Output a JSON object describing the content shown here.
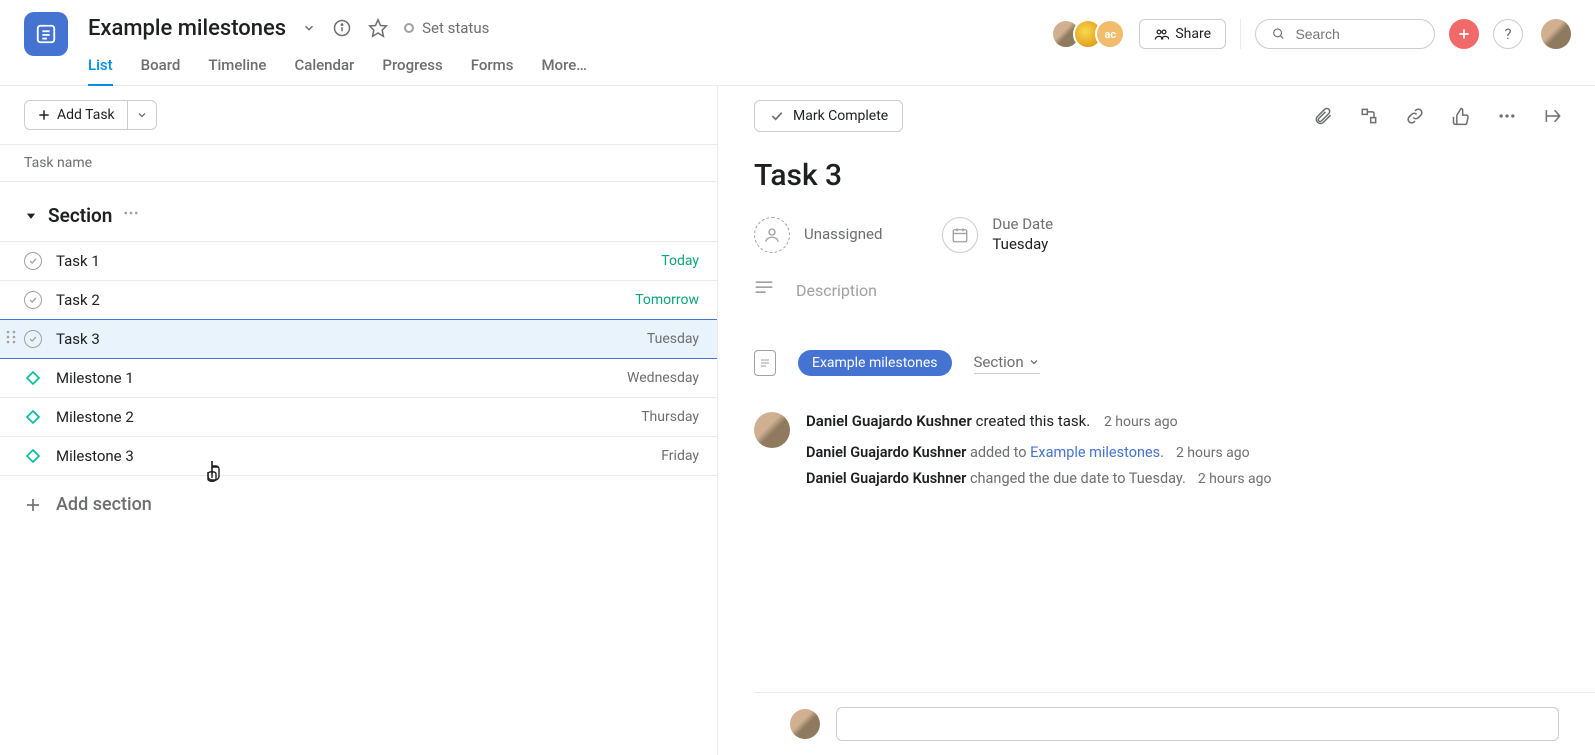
{
  "header": {
    "project_title": "Example milestones",
    "set_status": "Set status",
    "tabs": [
      "List",
      "Board",
      "Timeline",
      "Calendar",
      "Progress",
      "Forms",
      "More…"
    ],
    "active_tab_index": 0,
    "share": "Share",
    "search_placeholder": "Search",
    "avatar3_label": "ac"
  },
  "left": {
    "add_task": "Add Task",
    "column_header": "Task name",
    "section_title": "Section",
    "tasks": [
      {
        "name": "Task 1",
        "date": "Today",
        "date_class": "today",
        "type": "task"
      },
      {
        "name": "Task 2",
        "date": "Tomorrow",
        "date_class": "tomorrow",
        "type": "task"
      },
      {
        "name": "Task 3",
        "date": "Tuesday",
        "date_class": "",
        "type": "task",
        "selected": true
      },
      {
        "name": "Milestone 1",
        "date": "Wednesday",
        "date_class": "",
        "type": "milestone"
      },
      {
        "name": "Milestone 2",
        "date": "Thursday",
        "date_class": "",
        "type": "milestone"
      },
      {
        "name": "Milestone 3",
        "date": "Friday",
        "date_class": "",
        "type": "milestone"
      }
    ],
    "add_section": "Add section"
  },
  "detail": {
    "mark_complete": "Mark Complete",
    "title": "Task 3",
    "assignee_label": "Unassigned",
    "due_label": "Due Date",
    "due_value": "Tuesday",
    "description_ph": "Description",
    "project_pill": "Example milestones",
    "section_select": "Section",
    "activity": {
      "head_user": "Daniel Guajardo Kushner",
      "head_action": " created this task.",
      "head_time": "2 hours ago",
      "lines": [
        {
          "user": "Daniel Guajardo Kushner",
          "action": " added to ",
          "link": "Example milestones",
          "suffix": ".",
          "time": "2 hours ago"
        },
        {
          "user": "Daniel Guajardo Kushner",
          "action": " changed the due date to Tuesday.",
          "link": "",
          "suffix": "",
          "time": "2 hours ago"
        }
      ]
    }
  }
}
